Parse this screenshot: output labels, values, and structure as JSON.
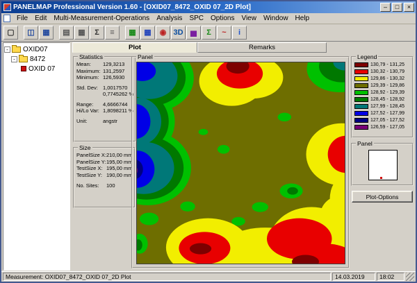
{
  "window": {
    "title": "PANELMAP  Professional Version 1.60  - [OXID07_8472_OXID 07_2D Plot]",
    "controls": {
      "minimize": "–",
      "maximize": "□",
      "close": "×"
    }
  },
  "menu": {
    "items": [
      {
        "label": "File"
      },
      {
        "label": "Edit"
      },
      {
        "label": "Multi-Measurement-Operations"
      },
      {
        "label": "Analysis"
      },
      {
        "label": "SPC"
      },
      {
        "label": "Options"
      },
      {
        "label": "View"
      },
      {
        "label": "Window"
      },
      {
        "label": "Help"
      }
    ]
  },
  "toolbar": {
    "items": [
      {
        "name": "new-document-icon",
        "glyph": "▢",
        "color": "#333333"
      },
      {
        "name": "cascade-windows-icon",
        "glyph": "◫",
        "color": "#234a9e"
      },
      {
        "name": "tile-windows-icon",
        "glyph": "▦",
        "color": "#234a9e"
      },
      {
        "name": "edit-table-icon",
        "glyph": "▤",
        "color": "#555555"
      },
      {
        "name": "data-grid-icon",
        "glyph": "▦",
        "color": "#555555"
      },
      {
        "name": "sum-table-icon",
        "glyph": "Σ",
        "color": "#333333"
      },
      {
        "name": "notes-icon",
        "glyph": "≡",
        "color": "#555555"
      },
      {
        "name": "map-2d-green-icon",
        "glyph": "▦",
        "color": "#188a18"
      },
      {
        "name": "map-2d-blue-icon",
        "glyph": "▦",
        "color": "#2244bb"
      },
      {
        "name": "wafer-map-icon",
        "glyph": "◉",
        "color": "#bb2222"
      },
      {
        "name": "view-3d-icon",
        "glyph": "3D",
        "color": "#0a4da0"
      },
      {
        "name": "bar-chart-icon",
        "glyph": "▅",
        "color": "#7a1fa0"
      },
      {
        "name": "sigma-statistics-icon",
        "glyph": "Σ",
        "color": "#188a18"
      },
      {
        "name": "spc-chart-icon",
        "glyph": "~",
        "color": "#bb2222"
      },
      {
        "name": "info-icon",
        "glyph": "i",
        "color": "#2255cc"
      }
    ]
  },
  "tree": {
    "items": [
      {
        "label": "OXID07"
      },
      {
        "label": "8472"
      },
      {
        "label": "OXID 07"
      }
    ]
  },
  "tabs": {
    "plot": "Plot",
    "remarks": "Remarks"
  },
  "statistics": {
    "title": "Statistics",
    "rows": [
      {
        "label": "Mean:",
        "value": "129,3213"
      },
      {
        "label": "Maximum:",
        "value": "131,2597"
      },
      {
        "label": "Minimum:",
        "value": "126,5930"
      },
      {
        "label": "Std. Dev:",
        "value": "1,0017570"
      },
      {
        "label": "",
        "value": "0,7745262 %"
      },
      {
        "label": "Range:",
        "value": "4,6666744"
      },
      {
        "label": "Hi/Lo Var:",
        "value": "1,8098211 %"
      },
      {
        "label": "Unit:",
        "value": "angstr"
      }
    ]
  },
  "size": {
    "title": "Size",
    "rows": [
      {
        "label": "PanelSize X:",
        "value": "210,00 mm"
      },
      {
        "label": "PanelSize Y:",
        "value": "195,00 mm"
      },
      {
        "label": "TestSize X:",
        "value": "195,00 mm"
      },
      {
        "label": "TestSize Y:",
        "value": "190,00 mm"
      },
      {
        "label": "No. Sites:",
        "value": "100"
      }
    ]
  },
  "panel": {
    "title": "Panel"
  },
  "legend": {
    "title": "Legend",
    "entries": [
      {
        "range": "130,79 - 131,25",
        "color": "#7d0000"
      },
      {
        "range": "130,32 - 130,79",
        "color": "#e80000"
      },
      {
        "range": "129,86 - 130,32",
        "color": "#f2ee00"
      },
      {
        "range": "129,39 - 129,86",
        "color": "#6e6e00"
      },
      {
        "range": "128,92 - 129,39",
        "color": "#00c000"
      },
      {
        "range": "128,45 - 128,92",
        "color": "#007800"
      },
      {
        "range": "127,99 - 128,45",
        "color": "#007878"
      },
      {
        "range": "127,52 - 127,99",
        "color": "#0000e6"
      },
      {
        "range": "127,05 - 127,52",
        "color": "#000080"
      },
      {
        "range": "126,59 - 127,05",
        "color": "#780078"
      }
    ]
  },
  "preview": {
    "title": "Panel"
  },
  "plot_options": {
    "label": "Plot-Options"
  },
  "statusbar": {
    "measurement": "Measurement: OXID07_8472_OXID 07_2D Plot",
    "date": "14.03.2019",
    "time": "18:02"
  }
}
